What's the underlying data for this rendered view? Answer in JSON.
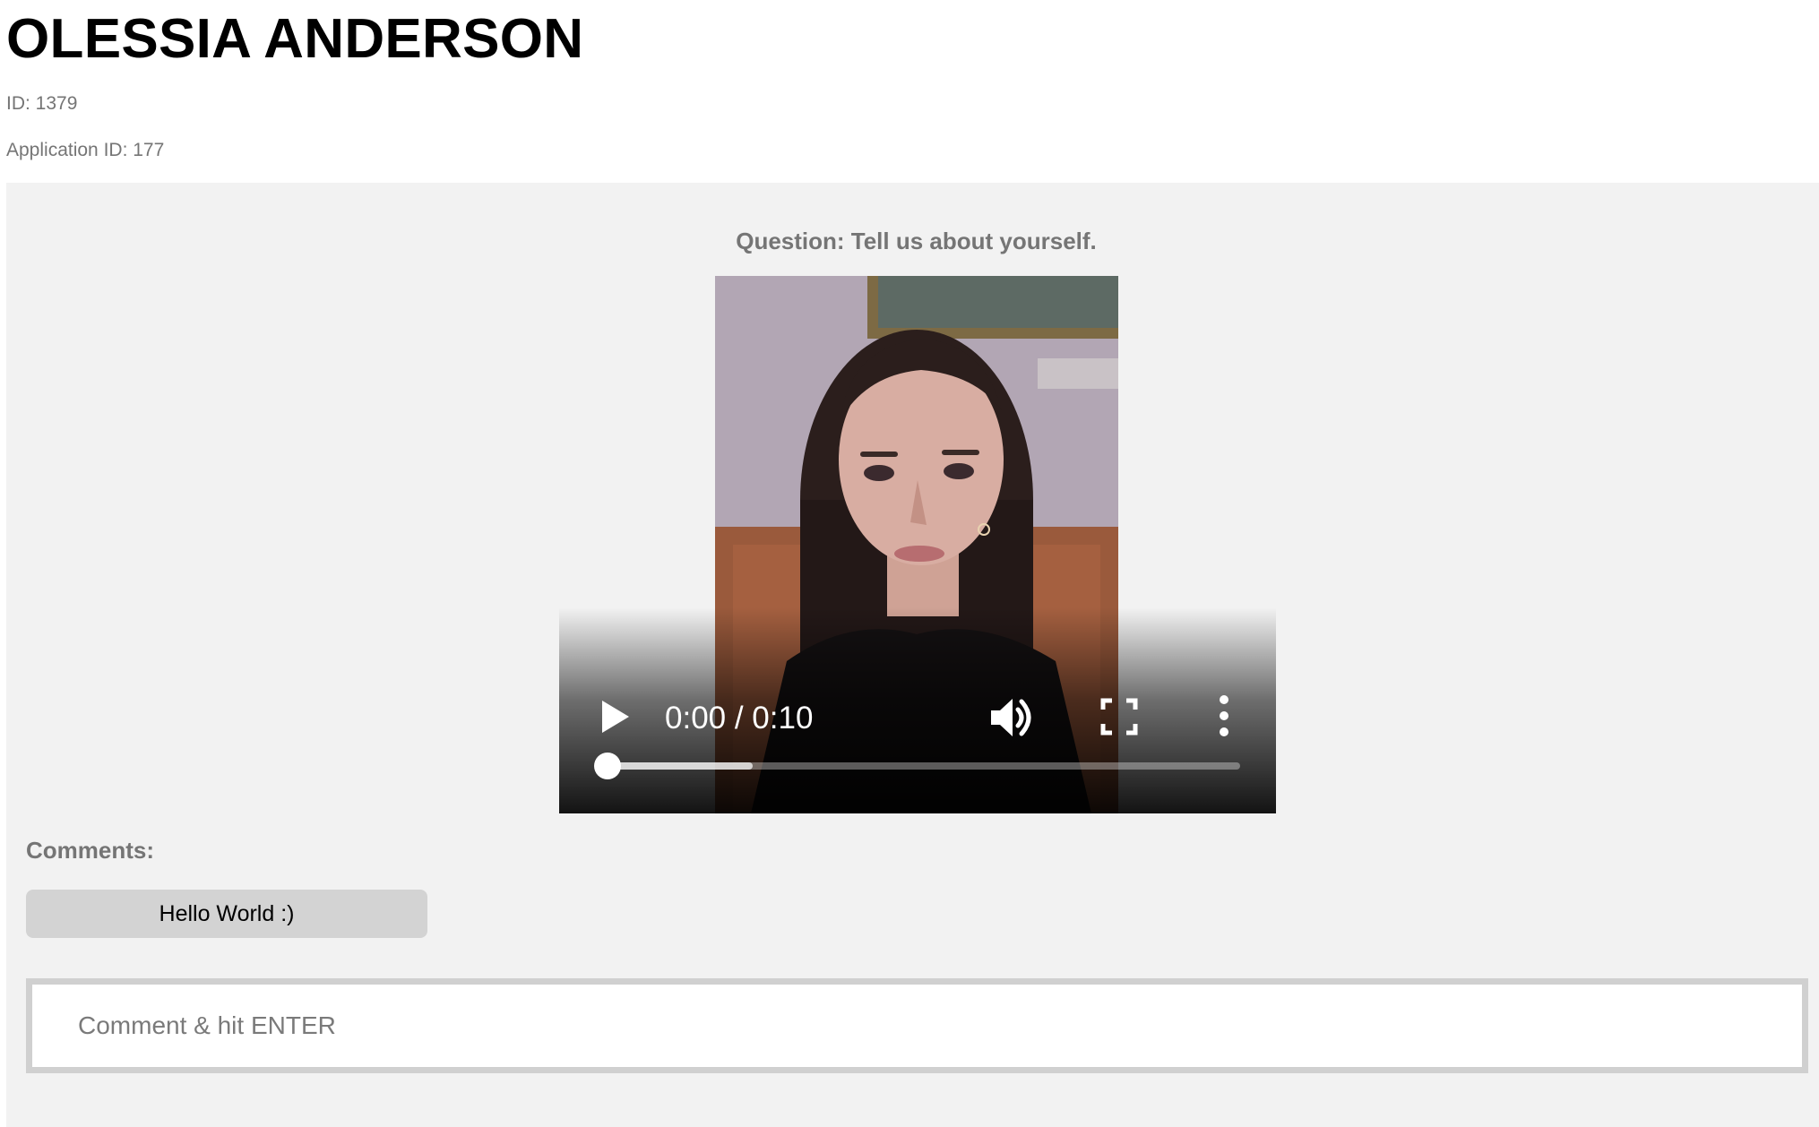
{
  "candidate": {
    "name": "OLESSIA ANDERSON",
    "id_label": "ID: 1379",
    "application_label": "Application ID: 177"
  },
  "question": {
    "text": "Question: Tell us about yourself."
  },
  "video": {
    "time_display": "0:00 / 0:10",
    "current_time": "0:00",
    "duration": "0:10",
    "progress": 0.0,
    "buffered": 0.23,
    "icons": {
      "play": "play-icon",
      "volume": "volume-icon",
      "fullscreen": "fullscreen-icon",
      "more": "more-options-icon"
    }
  },
  "comments": {
    "title": "Comments:",
    "items": [
      {
        "text": "Hello World :)"
      }
    ],
    "input_placeholder": "Comment & hit ENTER",
    "input_value": ""
  },
  "colors": {
    "panel_background": "#f2f2f2",
    "muted_text": "#757575",
    "comment_bubble": "#d3d3d3",
    "input_border": "#d0d0d0"
  }
}
